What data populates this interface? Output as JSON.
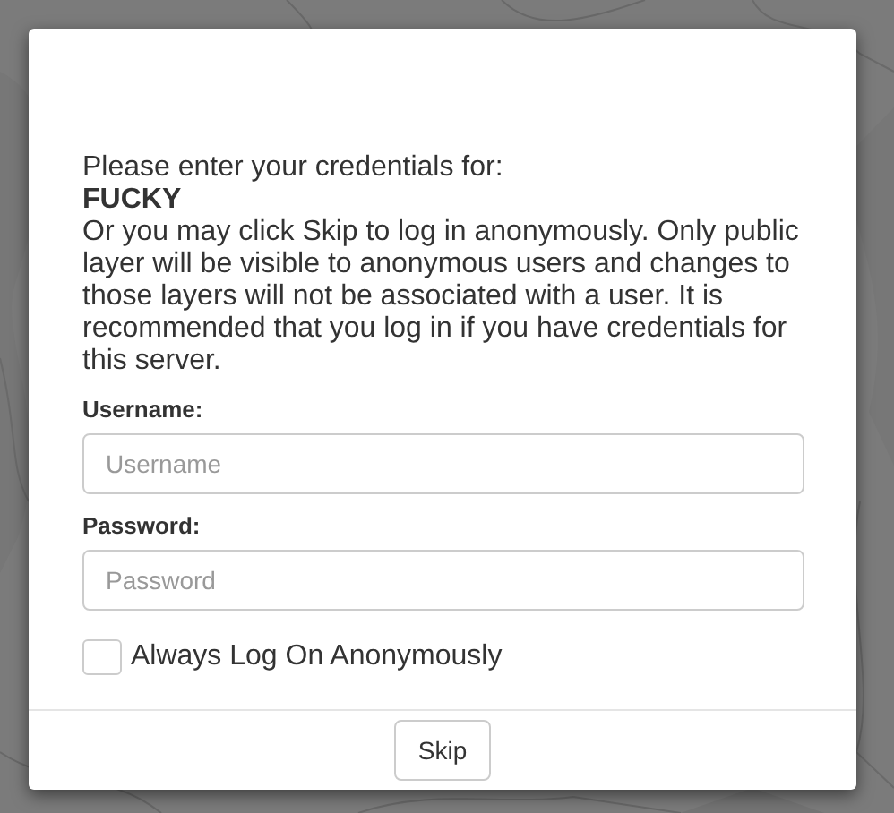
{
  "dialog": {
    "intro": "Please enter your credentials for:",
    "server": "FUCKY",
    "message": "Or you may click Skip to log in anonymously. Only public layer will be visible to anonymous users and changes to those layers will not be associated with a user. It is recommended that you log in if you have credentials for this server.",
    "fields": [
      {
        "label": "Username:",
        "placeholder": "Username"
      },
      {
        "label": "Password:",
        "placeholder": "Password"
      }
    ],
    "checkbox": {
      "label": "Always Log On Anonymously",
      "checked": false
    },
    "buttons": [
      "Skip"
    ]
  }
}
